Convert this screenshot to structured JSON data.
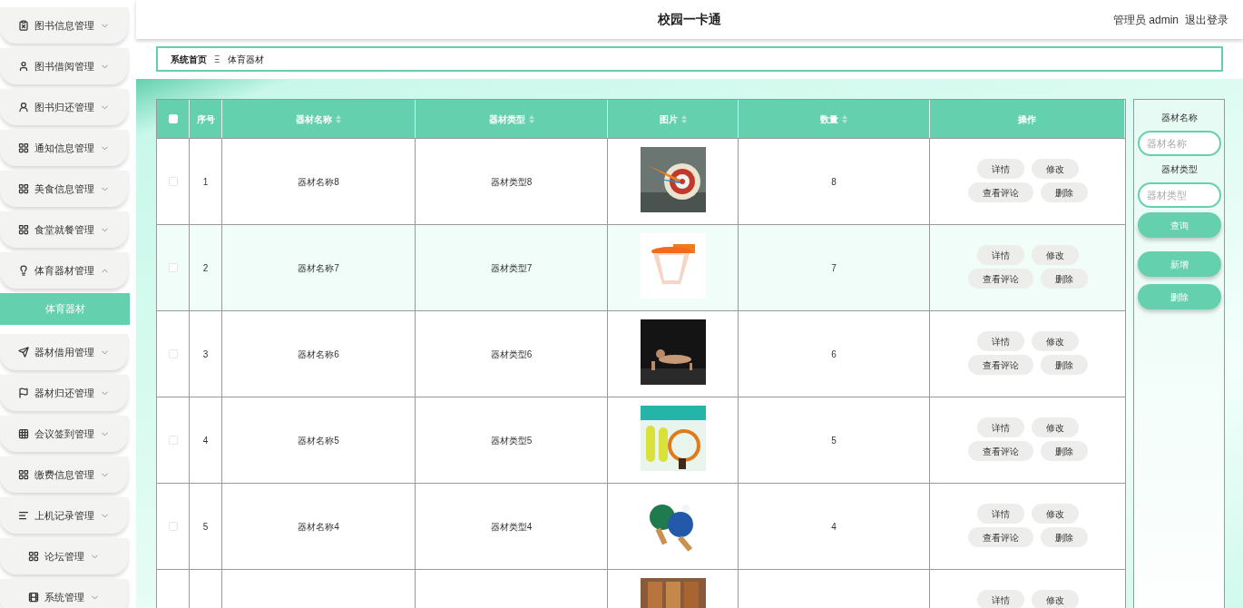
{
  "header": {
    "title": "校园一卡通",
    "user": "管理员 admin",
    "logout": "退出登录"
  },
  "sidebar": {
    "items": [
      {
        "label": "图书信息管理",
        "expanded": false
      },
      {
        "label": "图书借阅管理",
        "expanded": false
      },
      {
        "label": "图书归还管理",
        "expanded": false
      },
      {
        "label": "通知信息管理",
        "expanded": false
      },
      {
        "label": "美食信息管理",
        "expanded": false
      },
      {
        "label": "食堂就餐管理",
        "expanded": false
      },
      {
        "label": "体育器材管理",
        "expanded": true,
        "children": [
          {
            "label": "体育器材",
            "selected": true
          }
        ]
      },
      {
        "label": "器材借用管理",
        "expanded": false
      },
      {
        "label": "器材归还管理",
        "expanded": false
      },
      {
        "label": "会议签到管理",
        "expanded": false
      },
      {
        "label": "缴费信息管理",
        "expanded": false
      },
      {
        "label": "上机记录管理",
        "expanded": false
      },
      {
        "label": "论坛管理",
        "expanded": false
      },
      {
        "label": "系统管理",
        "expanded": false
      }
    ]
  },
  "breadcrumb": {
    "home": "系统首页",
    "separator": "Ξ",
    "current": "体育器材"
  },
  "table": {
    "header_checked": false,
    "columns": [
      {
        "label": "序号",
        "sortable": false
      },
      {
        "label": "器材名称",
        "sortable": true
      },
      {
        "label": "器材类型",
        "sortable": true
      },
      {
        "label": "图片",
        "sortable": true
      },
      {
        "label": "数量",
        "sortable": true
      },
      {
        "label": "操作",
        "sortable": false
      }
    ],
    "rows": [
      {
        "checked": false,
        "hovered": false,
        "index": "1",
        "name": "器材名称8",
        "type": "器材类型8",
        "quantity": "8",
        "buttons": [
          "详情",
          "修改",
          "查看评论",
          "删除"
        ]
      },
      {
        "checked": false,
        "hovered": true,
        "index": "2",
        "name": "器材名称7",
        "type": "器材类型7",
        "quantity": "7",
        "buttons": [
          "详情",
          "修改",
          "查看评论",
          "删除"
        ]
      },
      {
        "checked": false,
        "hovered": false,
        "index": "3",
        "name": "器材名称6",
        "type": "器材类型6",
        "quantity": "6",
        "buttons": [
          "详情",
          "修改",
          "查看评论",
          "删除"
        ]
      },
      {
        "checked": false,
        "hovered": false,
        "index": "4",
        "name": "器材名称5",
        "type": "器材类型5",
        "quantity": "5",
        "buttons": [
          "详情",
          "修改",
          "查看评论",
          "删除"
        ]
      },
      {
        "checked": false,
        "hovered": false,
        "index": "5",
        "name": "器材名称4",
        "type": "器材类型4",
        "quantity": "4",
        "buttons": [
          "详情",
          "修改",
          "查看评论",
          "删除"
        ]
      },
      {
        "hovered": false,
        "buttons": [
          "详情",
          "修改"
        ]
      }
    ]
  },
  "search_panel": {
    "fields": [
      {
        "label": "器材名称",
        "placeholder": "器材名称"
      },
      {
        "label": "器材类型",
        "placeholder": "器材类型"
      }
    ],
    "search_button": "查询",
    "add_button": "新增",
    "delete_button": "删除"
  }
}
